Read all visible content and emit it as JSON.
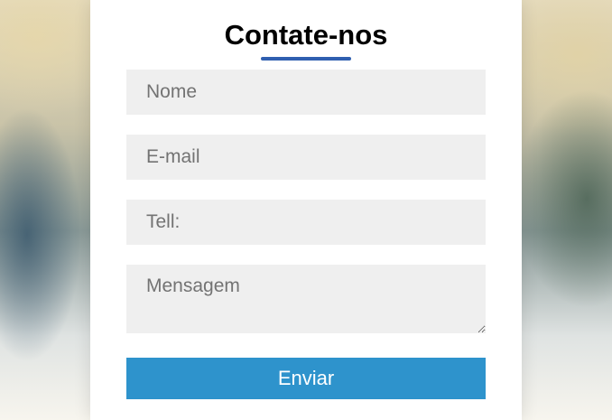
{
  "form": {
    "title": "Contate-nos",
    "fields": {
      "name_placeholder": "Nome",
      "email_placeholder": "E-mail",
      "phone_placeholder": "Tell:",
      "message_placeholder": "Mensagem"
    },
    "submit_label": "Enviar"
  },
  "colors": {
    "accent_underline": "#2f5fb0",
    "submit_button": "#2e93cc",
    "field_background": "#efefef"
  }
}
